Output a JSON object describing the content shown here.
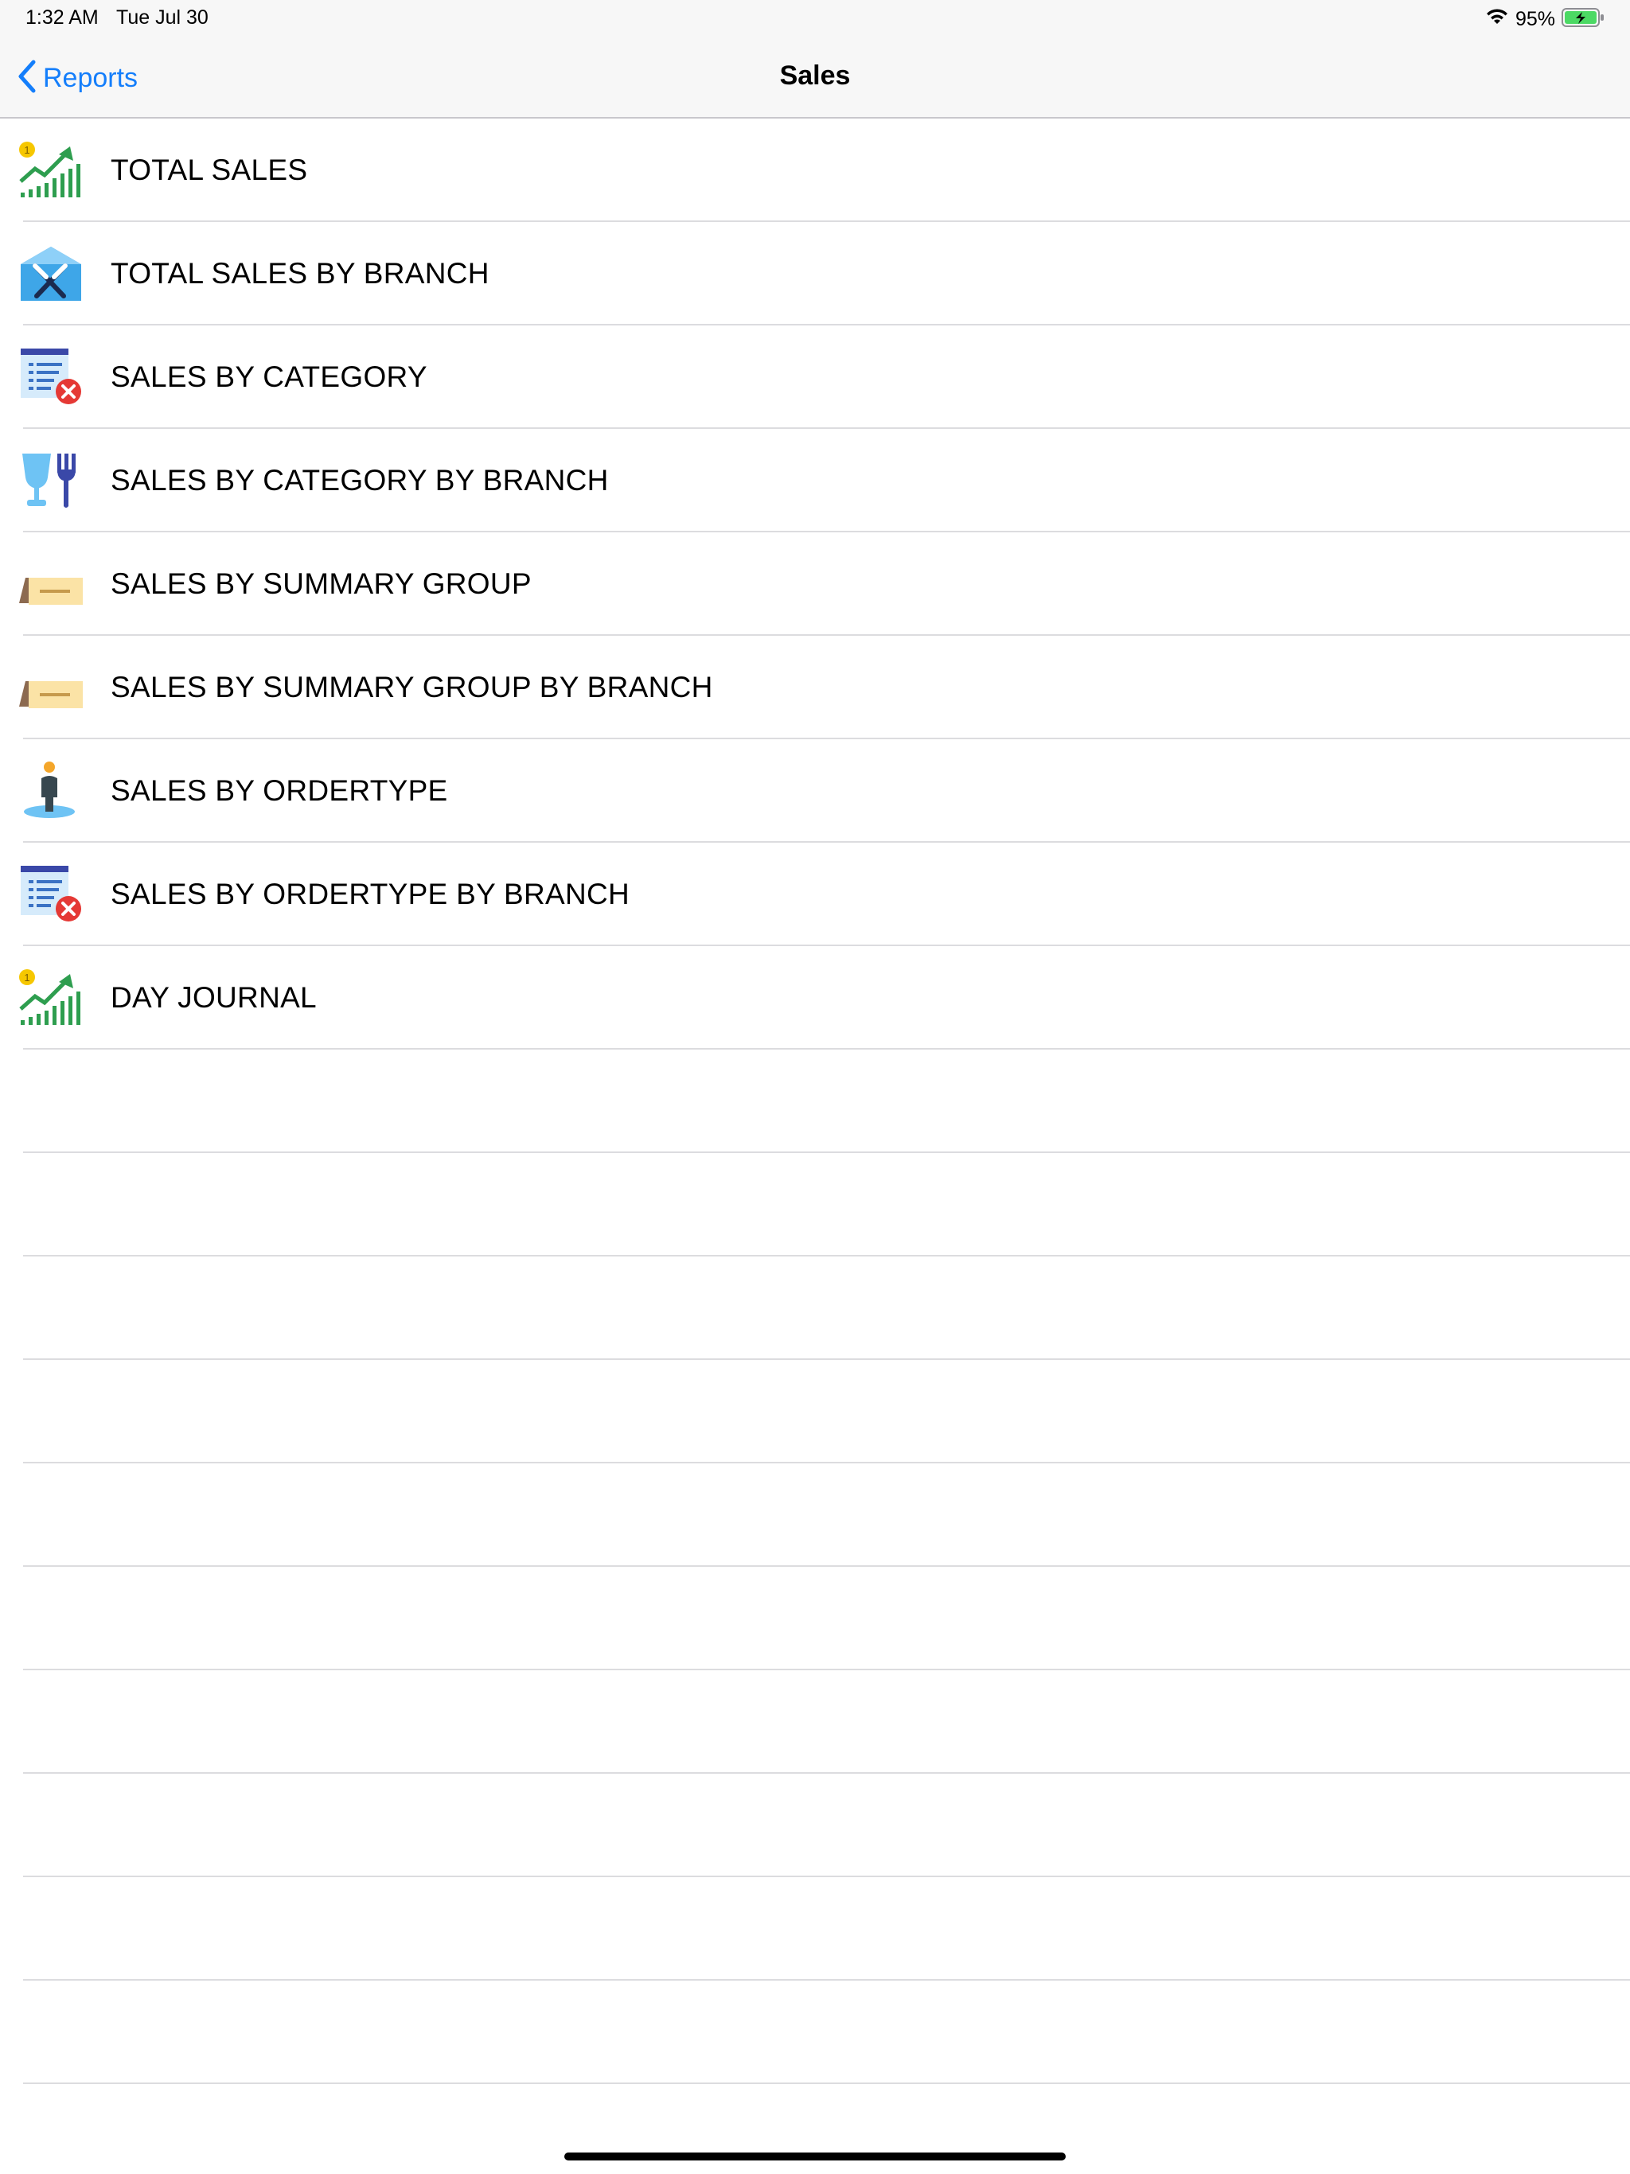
{
  "status_bar": {
    "time": "1:32 AM",
    "date": "Tue Jul 30",
    "battery": "95%"
  },
  "nav": {
    "back_label": "Reports",
    "title": "Sales"
  },
  "items": [
    {
      "label": "TOTAL SALES",
      "icon": "growth-chart-icon"
    },
    {
      "label": "TOTAL SALES BY BRANCH",
      "icon": "restaurant-tent-icon"
    },
    {
      "label": "SALES BY CATEGORY",
      "icon": "menu-list-cancel-icon"
    },
    {
      "label": "SALES BY CATEGORY BY BRANCH",
      "icon": "glass-fork-icon"
    },
    {
      "label": "SALES BY SUMMARY GROUP",
      "icon": "table-sign-icon"
    },
    {
      "label": "SALES BY SUMMARY GROUP BY BRANCH",
      "icon": "table-sign-icon"
    },
    {
      "label": "SALES BY ORDERTYPE",
      "icon": "person-pin-icon"
    },
    {
      "label": "SALES BY ORDERTYPE BY BRANCH",
      "icon": "menu-list-cancel-icon"
    },
    {
      "label": "DAY JOURNAL",
      "icon": "growth-chart-icon"
    }
  ],
  "colors": {
    "accent": "#147efb",
    "separator": "#dcdcdf",
    "nav_background": "#f7f7f7"
  }
}
